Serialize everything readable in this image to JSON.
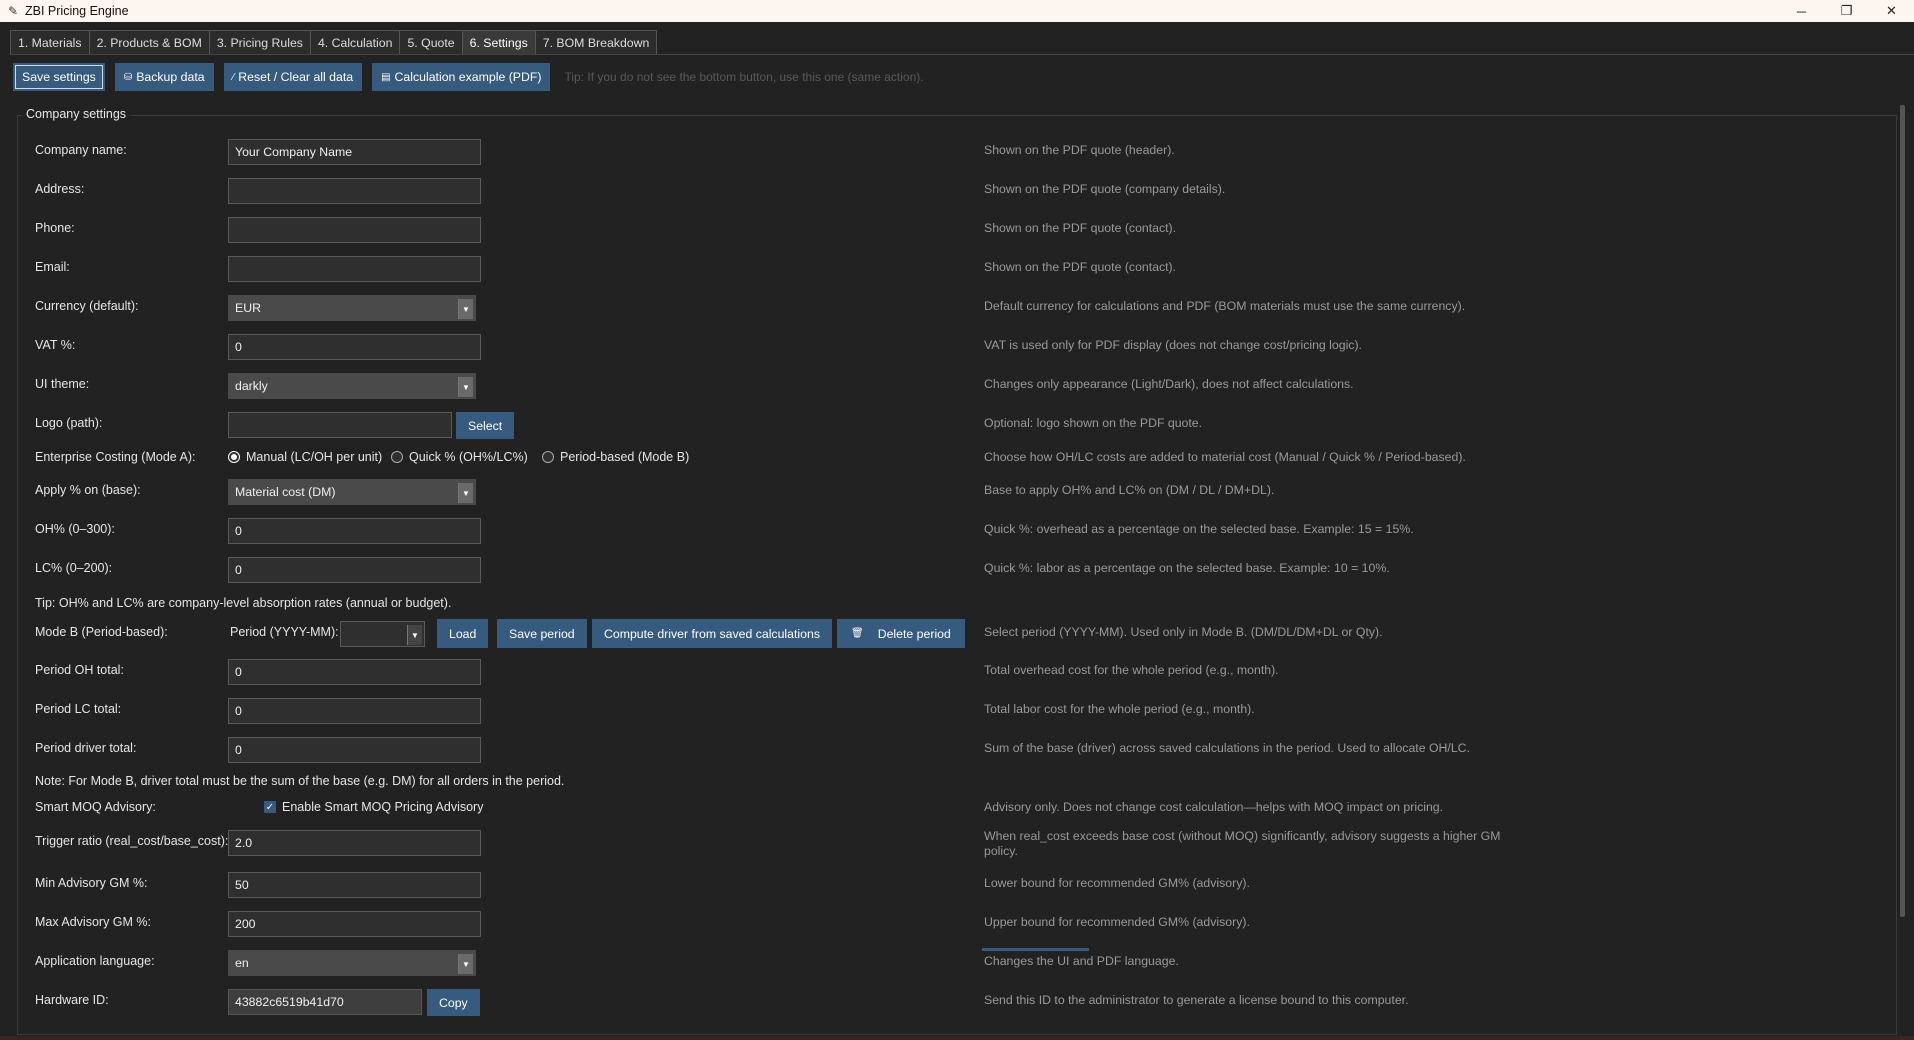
{
  "window": {
    "title": "ZBI Pricing Engine",
    "controls": {
      "minimize": "─",
      "maximize": "❐",
      "close": "✕"
    }
  },
  "tabs": [
    {
      "label": "1. Materials",
      "active": false
    },
    {
      "label": "2. Products & BOM",
      "active": false
    },
    {
      "label": "3. Pricing Rules",
      "active": false
    },
    {
      "label": "4. Calculation",
      "active": false
    },
    {
      "label": "5. Quote",
      "active": false
    },
    {
      "label": "6. Settings",
      "active": true
    },
    {
      "label": "7. BOM Breakdown",
      "active": false
    }
  ],
  "toolbar": {
    "save_label": "Save settings",
    "backup_label": "Backup data",
    "reset_label": "Reset / Clear all data",
    "example_label": "Calculation example (PDF)",
    "tip": "Tip: If you do not see the bottom button, use this one (same action)."
  },
  "group_title": "Company settings",
  "fields": {
    "company_name": {
      "label": "Company name:",
      "value": "Your Company Name",
      "help": "Shown on the PDF quote (header)."
    },
    "address": {
      "label": "Address:",
      "value": "",
      "help": "Shown on the PDF quote (company details)."
    },
    "phone": {
      "label": "Phone:",
      "value": "",
      "help": "Shown on the PDF quote (contact)."
    },
    "email": {
      "label": "Email:",
      "value": "",
      "help": "Shown on the PDF quote (contact)."
    },
    "currency": {
      "label": "Currency (default):",
      "value": "EUR",
      "help": "Default currency for calculations and PDF (BOM materials must use the same currency)."
    },
    "vat": {
      "label": "VAT %:",
      "value": "0",
      "help": "VAT is used only for PDF display (does not change cost/pricing logic)."
    },
    "ui_theme": {
      "label": "UI theme:",
      "value": "darkly",
      "help": "Changes only appearance (Light/Dark), does not affect calculations."
    },
    "logo": {
      "label": "Logo (path):",
      "value": "",
      "button": "Select",
      "help": "Optional: logo shown on the PDF quote."
    },
    "costing_mode": {
      "label": "Enterprise Costing (Mode A):",
      "options": [
        "Manual (LC/OH per unit)",
        "Quick % (OH%/LC%)",
        "Period-based (Mode B)"
      ],
      "selected": "Manual (LC/OH per unit)",
      "help": "Choose how OH/LC costs are added to material cost (Manual / Quick % / Period-based)."
    },
    "apply_base": {
      "label": "Apply % on (base):",
      "value": "Material cost (DM)",
      "help": "Base to apply OH% and LC% on (DM / DL / DM+DL)."
    },
    "oh_pct": {
      "label": "OH% (0–300):",
      "value": "0",
      "help": "Quick %: overhead as a percentage on the selected base. Example: 15 = 15%."
    },
    "lc_pct": {
      "label": "LC% (0–200):",
      "value": "0",
      "help": "Quick %: labor as a percentage on the selected base. Example: 10 = 10%."
    },
    "tip_note": "Tip: OH% and LC% are company-level absorption rates (annual or budget).",
    "mode_b": {
      "label": "Mode B (Period-based):",
      "period_label": "Period (YYYY-MM):",
      "period_value": "",
      "load": "Load",
      "save_period": "Save period",
      "compute": "Compute driver from saved calculations",
      "delete": "Delete period",
      "help": "Select period (YYYY-MM). Used only in Mode B. (DM/DL/DM+DL or Qty)."
    },
    "period_oh": {
      "label": "Period OH total:",
      "value": "0",
      "help": "Total overhead cost for the whole period (e.g., month)."
    },
    "period_lc": {
      "label": "Period LC total:",
      "value": "0",
      "help": "Total labor cost for the whole period (e.g., month)."
    },
    "period_driver": {
      "label": "Period driver total:",
      "value": "0",
      "help": "Sum of the base (driver) across saved calculations in the period. Used to allocate OH/LC."
    },
    "mode_b_note": "Note: For Mode B, driver total must be the sum of the base (e.g. DM) for all orders in the period.",
    "smart_moq": {
      "label": "Smart MOQ Advisory:",
      "checkbox": "Enable Smart MOQ Pricing Advisory",
      "checked": true,
      "help": "Advisory only. Does not change cost calculation—helps with MOQ impact on pricing."
    },
    "trigger_ratio": {
      "label": "Trigger ratio (real_cost/base_cost):",
      "value": "2.0",
      "help": "When real_cost exceeds base cost (without MOQ) significantly, advisory suggests a higher GM policy."
    },
    "min_gm": {
      "label": "Min Advisory GM %:",
      "value": "50",
      "help": "Lower bound for recommended GM% (advisory)."
    },
    "max_gm": {
      "label": "Max Advisory GM %:",
      "value": "200",
      "help": "Upper bound for recommended GM% (advisory)."
    },
    "language": {
      "label": "Application language:",
      "value": "en",
      "help": "Changes the UI and PDF language."
    },
    "hardware_id": {
      "label": "Hardware ID:",
      "value": "43882c6519b41d70",
      "button": "Copy",
      "help": "Send this ID to the administrator to generate a license bound to this computer."
    }
  },
  "colors": {
    "background": "#222222",
    "accent": "#375a7f",
    "input": "#2f2f2f",
    "combo": "#4a4a4a",
    "help_text": "#9a9a9a"
  }
}
